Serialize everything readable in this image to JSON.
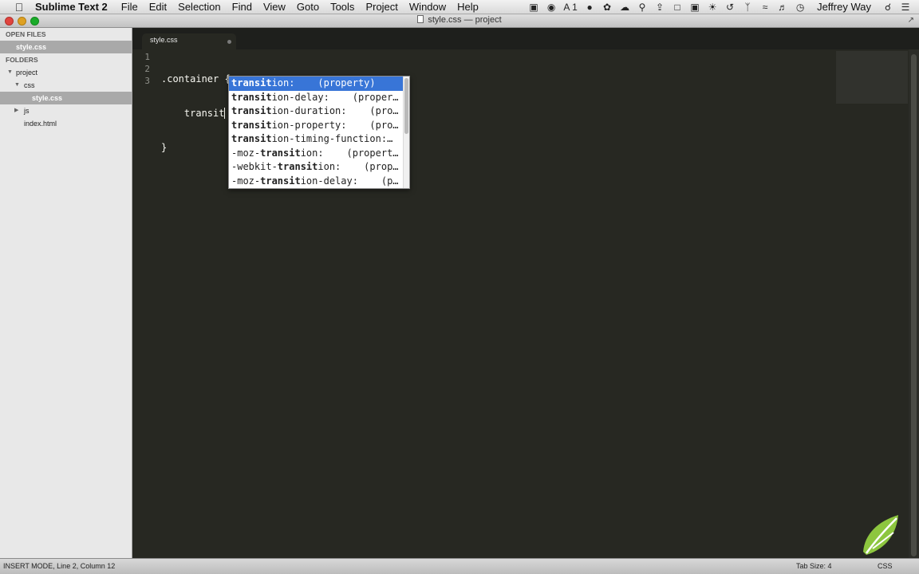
{
  "menubar": {
    "apple_icon": "apple-icon",
    "app_name": "Sublime Text 2",
    "items": [
      "File",
      "Edit",
      "Selection",
      "Find",
      "View",
      "Goto",
      "Tools",
      "Project",
      "Window",
      "Help"
    ],
    "tray_count": "1",
    "user": "Jeffrey Way"
  },
  "window": {
    "title": "style.css — project"
  },
  "sidebar": {
    "open_files_header": "OPEN FILES",
    "open_files": [
      {
        "label": "style.css"
      }
    ],
    "folders_header": "FOLDERS",
    "tree": {
      "project": "project",
      "css": "css",
      "style_css": "style.css",
      "js": "js",
      "index_html": "index.html"
    }
  },
  "tabs": [
    {
      "label": "style.css"
    }
  ],
  "editor": {
    "line_numbers": [
      "1",
      "2",
      "3"
    ],
    "lines": {
      "l1": ".container {",
      "l2_indent": "    ",
      "l2_typed": "transit",
      "l3": "}"
    }
  },
  "autocomplete": {
    "items": [
      {
        "pre": "",
        "match": "transit",
        "post": "ion:",
        "hint": "    (property)"
      },
      {
        "pre": "",
        "match": "transit",
        "post": "ion-delay:",
        "hint": "    (proper…"
      },
      {
        "pre": "",
        "match": "transit",
        "post": "ion-duration:",
        "hint": "    (pro…"
      },
      {
        "pre": "",
        "match": "transit",
        "post": "ion-property:",
        "hint": "    (pro…"
      },
      {
        "pre": "",
        "match": "transit",
        "post": "ion-timing-function:",
        "hint": "…"
      },
      {
        "pre": "-moz-",
        "match": "transit",
        "post": "ion:",
        "hint": "    (propert…"
      },
      {
        "pre": "-webkit-",
        "match": "transit",
        "post": "ion:",
        "hint": "    (prop…"
      },
      {
        "pre": "-moz-",
        "match": "transit",
        "post": "ion-delay:",
        "hint": "    (p…"
      }
    ]
  },
  "statusbar": {
    "left": "INSERT MODE, Line 2, Column 12",
    "tab_size": "Tab Size: 4",
    "syntax": "CSS"
  },
  "colors": {
    "editor_bg": "#272822",
    "popup_selection": "#3875d7",
    "logo_green": "#8dc63f"
  }
}
